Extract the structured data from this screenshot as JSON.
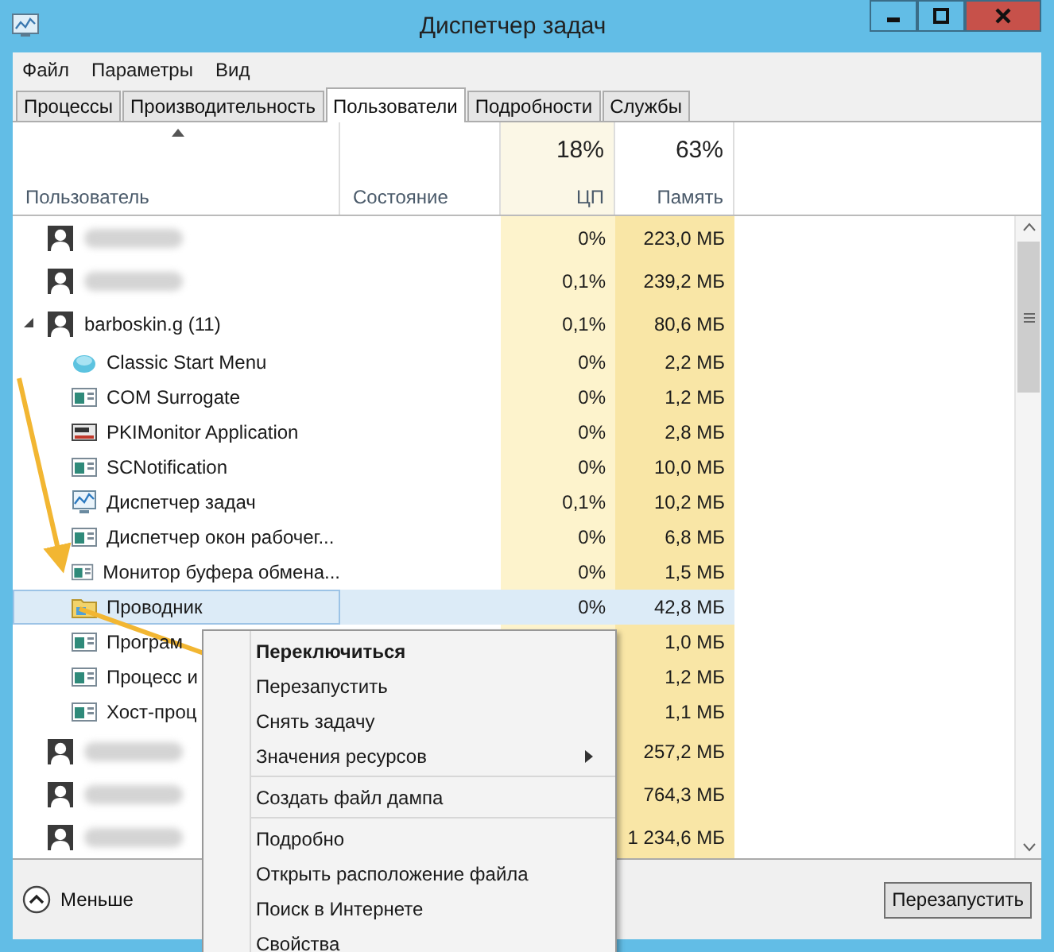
{
  "window": {
    "title": "Диспетчер задач"
  },
  "menu": [
    "Файл",
    "Параметры",
    "Вид"
  ],
  "tabs": [
    {
      "label": "Процессы",
      "selected": false
    },
    {
      "label": "Производительность",
      "selected": false
    },
    {
      "label": "Пользователи",
      "selected": true
    },
    {
      "label": "Подробности",
      "selected": false
    },
    {
      "label": "Службы",
      "selected": false
    }
  ],
  "columns": [
    {
      "label": "Пользователь",
      "sorted": true
    },
    {
      "label": "Состояние",
      "sorted": false
    },
    {
      "label": "ЦП",
      "total": "18%",
      "sorted": false
    },
    {
      "label": "Память",
      "total": "63%",
      "sorted": false
    }
  ],
  "rows": [
    {
      "kind": "user",
      "blurred": true,
      "cpu": "0%",
      "memory": "223,0 МБ",
      "selected": false
    },
    {
      "kind": "user",
      "blurred": true,
      "cpu": "0,1%",
      "memory": "239,2 МБ",
      "selected": false
    },
    {
      "kind": "user",
      "name": "barboskin.g (11)",
      "cpu": "0,1%",
      "memory": "80,6 МБ",
      "expanded": true,
      "selected": false,
      "children": [
        {
          "kind": "globe",
          "name": "Classic Start Menu",
          "cpu": "0%",
          "memory": "2,2 МБ",
          "selected": false
        },
        {
          "kind": "window",
          "name": "COM Surrogate",
          "cpu": "0%",
          "memory": "1,2 МБ",
          "selected": false
        },
        {
          "kind": "device",
          "name": "PKIMonitor Application",
          "cpu": "0%",
          "memory": "2,8 МБ",
          "selected": false
        },
        {
          "kind": "window",
          "name": "SCNotification",
          "cpu": "0%",
          "memory": "10,0 МБ",
          "selected": false
        },
        {
          "kind": "chart",
          "name": "Диспетчер задач",
          "cpu": "0,1%",
          "memory": "10,2 МБ",
          "selected": false
        },
        {
          "kind": "window",
          "name": "Диспетчер окон рабочег...",
          "cpu": "0%",
          "memory": "6,8 МБ",
          "selected": false
        },
        {
          "kind": "window",
          "name": "Монитор буфера обмена...",
          "cpu": "0%",
          "memory": "1,5 МБ",
          "selected": false
        },
        {
          "kind": "folder",
          "name": "Проводник",
          "cpu": "0%",
          "memory": "42,8 МБ",
          "selected": true
        },
        {
          "kind": "window",
          "name": "Програм",
          "memory": "1,0 МБ",
          "selected": false
        },
        {
          "kind": "window",
          "name": "Процесс и",
          "memory": "1,2 МБ",
          "selected": false
        },
        {
          "kind": "window",
          "name": "Хост-проц",
          "memory": "1,1 МБ",
          "selected": false
        }
      ]
    },
    {
      "kind": "user",
      "blurred": true,
      "memory": "257,2 МБ",
      "selected": false
    },
    {
      "kind": "user",
      "blurred": true,
      "memory": "764,3 МБ",
      "selected": false
    },
    {
      "kind": "user",
      "blurred": true,
      "memory": "1 234,6 МБ",
      "selected": false
    }
  ],
  "footer": {
    "toggle": "Меньше",
    "button": "Перезапустить"
  },
  "context_menu": [
    {
      "kind": "item",
      "label": "Переключиться",
      "bold": true,
      "submenu": false
    },
    {
      "kind": "item",
      "label": "Перезапустить",
      "bold": false,
      "submenu": false
    },
    {
      "kind": "item",
      "label": "Снять задачу",
      "bold": false,
      "submenu": false
    },
    {
      "kind": "item",
      "label": "Значения ресурсов",
      "bold": false,
      "submenu": true
    },
    {
      "kind": "separator"
    },
    {
      "kind": "item",
      "label": "Создать файл дампа",
      "bold": false,
      "submenu": false
    },
    {
      "kind": "separator"
    },
    {
      "kind": "item",
      "label": "Подробно",
      "bold": false,
      "submenu": false
    },
    {
      "kind": "item",
      "label": "Открыть расположение файла",
      "bold": false,
      "submenu": false
    },
    {
      "kind": "item",
      "label": "Поиск в Интернете",
      "bold": false,
      "submenu": false
    },
    {
      "kind": "item",
      "label": "Свойства",
      "bold": false,
      "submenu": false
    }
  ]
}
